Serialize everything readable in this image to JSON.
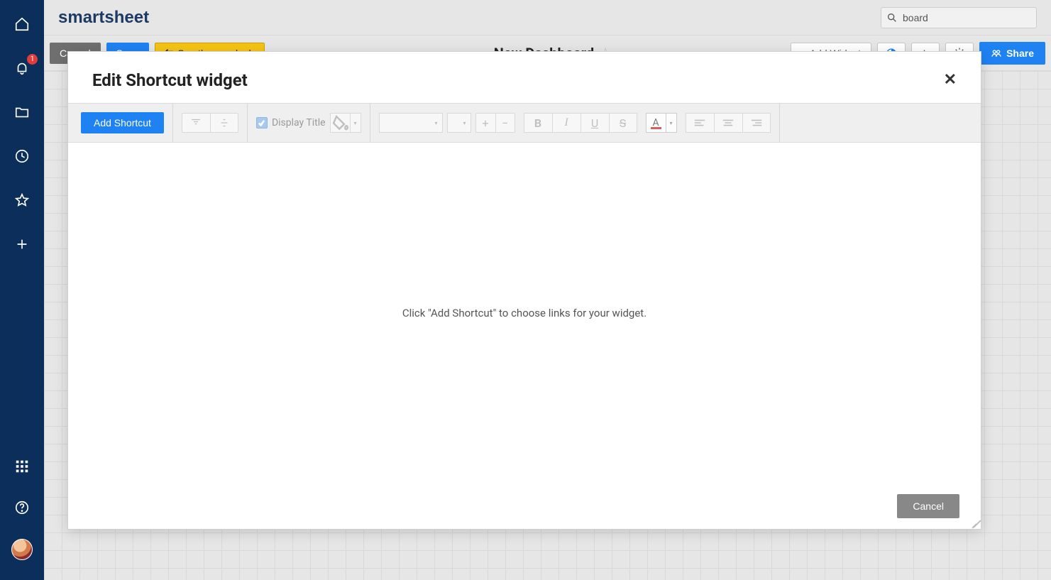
{
  "brand": "smartsheet",
  "search": {
    "value": "board"
  },
  "notifications": {
    "badge": "1"
  },
  "dashboard_header": {
    "cancel": "Cancel",
    "save": "Save",
    "new_look": "See the new look",
    "title": "New Dashboard",
    "add_widget": "+ Add Widget",
    "share": "Share"
  },
  "modal": {
    "title": "Edit Shortcut widget",
    "toolbar": {
      "add_shortcut": "Add Shortcut",
      "display_title": "Display Title"
    },
    "placeholder": "Click \"Add Shortcut\" to choose links for your widget.",
    "cancel": "Cancel"
  }
}
